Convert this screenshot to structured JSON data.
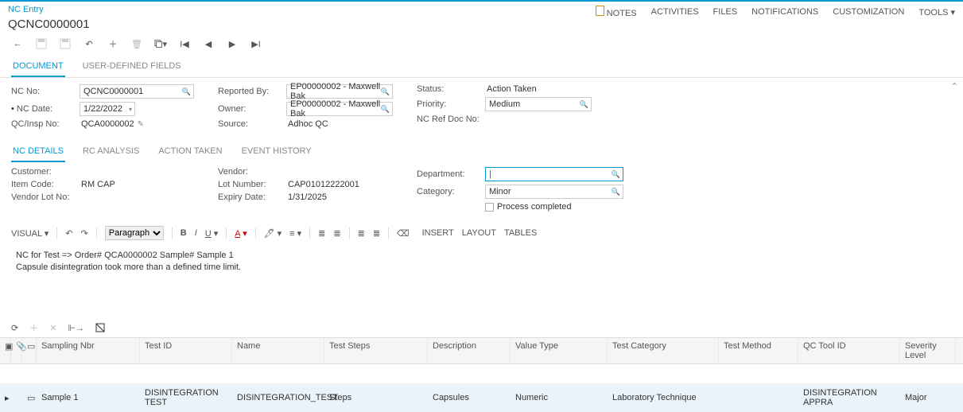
{
  "header": {
    "breadcrumb": "NC Entry",
    "doc_title": "QCNC0000001",
    "links": {
      "notes": "NOTES",
      "activities": "ACTIVITIES",
      "files": "FILES",
      "notifications": "NOTIFICATIONS",
      "customization": "CUSTOMIZATION",
      "tools": "TOOLS"
    }
  },
  "doc_tabs": {
    "document": "DOCUMENT",
    "udf": "USER-DEFINED FIELDS"
  },
  "form": {
    "nc_no_label": "NC No:",
    "nc_no": "QCNC0000001",
    "nc_date_label": "NC Date:",
    "nc_date": "1/22/2022",
    "qcinsp_label": "QC/Insp No:",
    "qcinsp": "QCA0000002",
    "reported_by_label": "Reported By:",
    "reported_by": "EP00000002 - Maxwell Bak",
    "owner_label": "Owner:",
    "owner": "EP00000002 - Maxwell Bak",
    "source_label": "Source:",
    "source": "Adhoc QC",
    "status_label": "Status:",
    "status": "Action Taken",
    "priority_label": "Priority:",
    "priority": "Medium",
    "ncref_label": "NC Ref Doc No:"
  },
  "sub_tabs": {
    "nc_details": "NC DETAILS",
    "rc_analysis": "RC ANALYSIS",
    "action_taken": "ACTION TAKEN",
    "event_history": "EVENT HISTORY"
  },
  "details": {
    "customer_label": "Customer:",
    "item_code_label": "Item Code:",
    "item_code": "RM CAP",
    "vendor_lot_label": "Vendor Lot No:",
    "vendor_label": "Vendor:",
    "lot_label": "Lot Number:",
    "lot": "CAP01012222001",
    "expiry_label": "Expiry Date:",
    "expiry": "1/31/2025",
    "department_label": "Department:",
    "category_label": "Category:",
    "category": "Minor",
    "process_completed_label": "Process completed"
  },
  "editor": {
    "visual_label": "VISUAL",
    "paragraph": "Paragraph",
    "insert": "INSERT",
    "layout": "LAYOUT",
    "tables": "TABLES",
    "line1": "NC for Test => Order# QCA0000002 Sample# Sample 1",
    "line2": "Capsule disintegration took more than a defined time limit."
  },
  "grid": {
    "headers": {
      "sampling": "Sampling Nbr",
      "test_id": "Test ID",
      "name": "Name",
      "steps": "Test Steps",
      "desc": "Description",
      "vtype": "Value Type",
      "tcat": "Test Category",
      "tmethod": "Test Method",
      "qctool": "QC Tool ID",
      "sev": "Severity Level"
    },
    "row": {
      "sampling": "Sample 1",
      "test_id": "DISINTEGRATION TEST",
      "name": "DISINTEGRATION_TEST",
      "steps": "Steps",
      "desc": "Capsules",
      "vtype": "Numeric",
      "tcat": "Laboratory Technique",
      "tmethod": "",
      "qctool": "DISINTEGRATION APPRA",
      "sev": "Major"
    }
  }
}
